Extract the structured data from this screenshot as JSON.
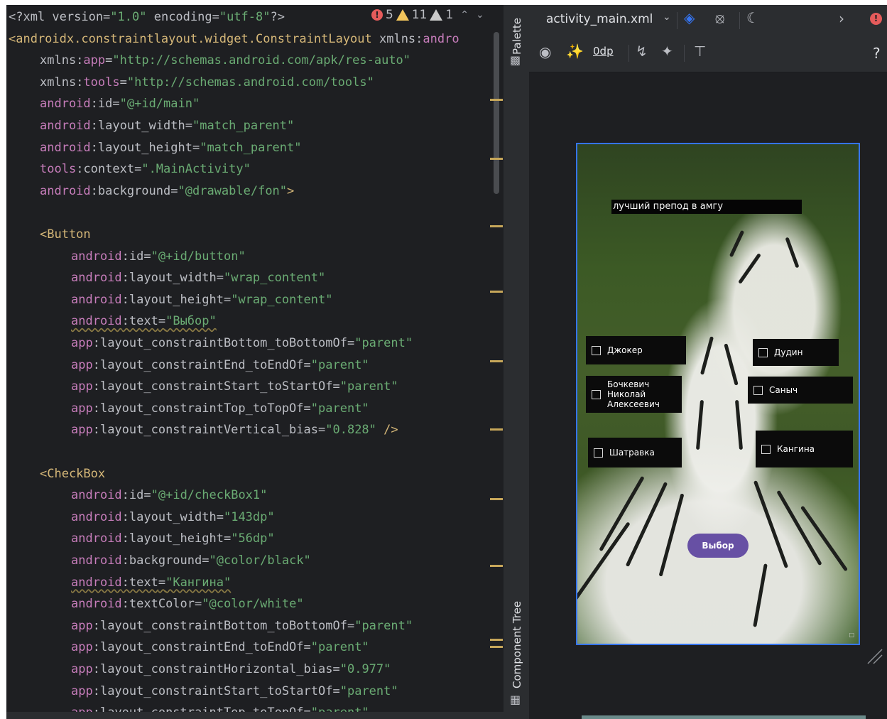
{
  "editor": {
    "inspections": {
      "errors": "5",
      "warnings": "11",
      "weak_warnings": "1"
    },
    "lines": [
      {
        "indent": 0,
        "parts": [
          [
            "decl",
            "<?xml version="
          ],
          [
            "str",
            "\"1.0\""
          ],
          [
            "decl",
            " encoding="
          ],
          [
            "str",
            "\"utf-8\""
          ],
          [
            "decl",
            "?>"
          ]
        ]
      },
      {
        "indent": 0,
        "parts": [
          [
            "tag",
            "<androidx.constraintlayout.widget.ConstraintLayout "
          ],
          [
            "attr",
            "xmlns:"
          ],
          [
            "ns",
            "andro"
          ]
        ]
      },
      {
        "indent": 1,
        "parts": [
          [
            "attr",
            "xmlns:"
          ],
          [
            "ns",
            "app"
          ],
          [
            "eq",
            "="
          ],
          [
            "str",
            "\"http://schemas.android.com/apk/res-auto\""
          ]
        ]
      },
      {
        "indent": 1,
        "parts": [
          [
            "attr",
            "xmlns:"
          ],
          [
            "ns",
            "tools"
          ],
          [
            "eq",
            "="
          ],
          [
            "str",
            "\"http://schemas.android.com/tools\""
          ]
        ]
      },
      {
        "indent": 1,
        "parts": [
          [
            "ns",
            "android"
          ],
          [
            "attr",
            ":id"
          ],
          [
            "eq",
            "="
          ],
          [
            "str",
            "\"@+id/main\""
          ]
        ]
      },
      {
        "indent": 1,
        "parts": [
          [
            "ns",
            "android"
          ],
          [
            "attr",
            ":layout_width"
          ],
          [
            "eq",
            "="
          ],
          [
            "str",
            "\"match_parent\""
          ]
        ]
      },
      {
        "indent": 1,
        "parts": [
          [
            "ns",
            "android"
          ],
          [
            "attr",
            ":layout_height"
          ],
          [
            "eq",
            "="
          ],
          [
            "str",
            "\"match_parent\""
          ]
        ]
      },
      {
        "indent": 1,
        "parts": [
          [
            "ns",
            "tools"
          ],
          [
            "attr",
            ":context"
          ],
          [
            "eq",
            "="
          ],
          [
            "str",
            "\".MainActivity\""
          ]
        ]
      },
      {
        "indent": 1,
        "parts": [
          [
            "ns",
            "android"
          ],
          [
            "attr",
            ":background"
          ],
          [
            "eq",
            "="
          ],
          [
            "str",
            "\"@drawable/fon\""
          ],
          [
            "punc",
            ">"
          ]
        ]
      },
      {
        "indent": 0,
        "parts": []
      },
      {
        "indent": 1,
        "parts": [
          [
            "tag",
            "<Button"
          ]
        ]
      },
      {
        "indent": 2,
        "parts": [
          [
            "ns",
            "android"
          ],
          [
            "attr",
            ":id"
          ],
          [
            "eq",
            "="
          ],
          [
            "str",
            "\"@+id/button\""
          ]
        ]
      },
      {
        "indent": 2,
        "parts": [
          [
            "ns",
            "android"
          ],
          [
            "attr",
            ":layout_width"
          ],
          [
            "eq",
            "="
          ],
          [
            "str",
            "\"wrap_content\""
          ]
        ]
      },
      {
        "indent": 2,
        "parts": [
          [
            "ns",
            "android"
          ],
          [
            "attr",
            ":layout_height"
          ],
          [
            "eq",
            "="
          ],
          [
            "str",
            "\"wrap_content\""
          ]
        ]
      },
      {
        "indent": 2,
        "warn": true,
        "parts": [
          [
            "ns",
            "android"
          ],
          [
            "attr",
            ":text"
          ],
          [
            "eq",
            "="
          ],
          [
            "str",
            "\"Выбор\""
          ]
        ]
      },
      {
        "indent": 2,
        "parts": [
          [
            "ns",
            "app"
          ],
          [
            "attr",
            ":layout_constraintBottom_toBottomOf"
          ],
          [
            "eq",
            "="
          ],
          [
            "str",
            "\"parent\""
          ]
        ]
      },
      {
        "indent": 2,
        "parts": [
          [
            "ns",
            "app"
          ],
          [
            "attr",
            ":layout_constraintEnd_toEndOf"
          ],
          [
            "eq",
            "="
          ],
          [
            "str",
            "\"parent\""
          ]
        ]
      },
      {
        "indent": 2,
        "parts": [
          [
            "ns",
            "app"
          ],
          [
            "attr",
            ":layout_constraintStart_toStartOf"
          ],
          [
            "eq",
            "="
          ],
          [
            "str",
            "\"parent\""
          ]
        ]
      },
      {
        "indent": 2,
        "parts": [
          [
            "ns",
            "app"
          ],
          [
            "attr",
            ":layout_constraintTop_toTopOf"
          ],
          [
            "eq",
            "="
          ],
          [
            "str",
            "\"parent\""
          ]
        ]
      },
      {
        "indent": 2,
        "parts": [
          [
            "ns",
            "app"
          ],
          [
            "attr",
            ":layout_constraintVertical_bias"
          ],
          [
            "eq",
            "="
          ],
          [
            "str",
            "\"0.828\""
          ],
          [
            "punc",
            " />"
          ]
        ]
      },
      {
        "indent": 0,
        "parts": []
      },
      {
        "indent": 1,
        "parts": [
          [
            "tag",
            "<CheckBox"
          ]
        ]
      },
      {
        "indent": 2,
        "parts": [
          [
            "ns",
            "android"
          ],
          [
            "attr",
            ":id"
          ],
          [
            "eq",
            "="
          ],
          [
            "str",
            "\"@+id/checkBox1\""
          ]
        ]
      },
      {
        "indent": 2,
        "parts": [
          [
            "ns",
            "android"
          ],
          [
            "attr",
            ":layout_width"
          ],
          [
            "eq",
            "="
          ],
          [
            "str",
            "\"143dp\""
          ]
        ]
      },
      {
        "indent": 2,
        "parts": [
          [
            "ns",
            "android"
          ],
          [
            "attr",
            ":layout_height"
          ],
          [
            "eq",
            "="
          ],
          [
            "str",
            "\"56dp\""
          ]
        ]
      },
      {
        "indent": 2,
        "parts": [
          [
            "ns",
            "android"
          ],
          [
            "attr",
            ":background"
          ],
          [
            "eq",
            "="
          ],
          [
            "str",
            "\"@color/black\""
          ]
        ]
      },
      {
        "indent": 2,
        "warn": true,
        "parts": [
          [
            "ns",
            "android"
          ],
          [
            "attr",
            ":text"
          ],
          [
            "eq",
            "="
          ],
          [
            "str",
            "\"Кангина\""
          ]
        ]
      },
      {
        "indent": 2,
        "parts": [
          [
            "ns",
            "android"
          ],
          [
            "attr",
            ":textColor"
          ],
          [
            "eq",
            "="
          ],
          [
            "str",
            "\"@color/white\""
          ]
        ]
      },
      {
        "indent": 2,
        "parts": [
          [
            "ns",
            "app"
          ],
          [
            "attr",
            ":layout_constraintBottom_toBottomOf"
          ],
          [
            "eq",
            "="
          ],
          [
            "str",
            "\"parent\""
          ]
        ]
      },
      {
        "indent": 2,
        "parts": [
          [
            "ns",
            "app"
          ],
          [
            "attr",
            ":layout_constraintEnd_toEndOf"
          ],
          [
            "eq",
            "="
          ],
          [
            "str",
            "\"parent\""
          ]
        ]
      },
      {
        "indent": 2,
        "parts": [
          [
            "ns",
            "app"
          ],
          [
            "attr",
            ":layout_constraintHorizontal_bias"
          ],
          [
            "eq",
            "="
          ],
          [
            "str",
            "\"0.977\""
          ]
        ]
      },
      {
        "indent": 2,
        "parts": [
          [
            "ns",
            "app"
          ],
          [
            "attr",
            ":layout_constraintStart_toStartOf"
          ],
          [
            "eq",
            "="
          ],
          [
            "str",
            "\"parent\""
          ]
        ]
      },
      {
        "indent": 2,
        "parts": [
          [
            "ns",
            "app"
          ],
          [
            "attr",
            ":layout_constraintTop_toTopOf"
          ],
          [
            "eq",
            "="
          ],
          [
            "str",
            "\"parent\""
          ]
        ]
      }
    ]
  },
  "tool_strip": {
    "palette_label": "Palette",
    "component_tree_label": "Component Tree"
  },
  "design": {
    "file_tab": "activity_main.xml",
    "margin_value": "0dp",
    "help_label": "?",
    "title_text": "лучший препод в амгу",
    "checkboxes": [
      {
        "id": "dzhoker",
        "label": "Джокер",
        "checked": false
      },
      {
        "id": "dudin",
        "label": "Дудин",
        "checked": false
      },
      {
        "id": "bochkevich",
        "label": "Бочкевич\nНиколай\nАлексеевич",
        "checked": false
      },
      {
        "id": "sanych",
        "label": "Саныч",
        "checked": false
      },
      {
        "id": "shatravka",
        "label": "Шатравка",
        "checked": false
      },
      {
        "id": "kangina",
        "label": "Кангина",
        "checked": false
      }
    ],
    "choose_button": "Выбор"
  },
  "colors": {
    "editor_bg": "#1e1f22",
    "string": "#6aab73",
    "tag": "#d5b778",
    "namespace": "#c77dbb",
    "selection_outline": "#3574f0",
    "material_button": "#6750a4",
    "error": "#e55b5b"
  }
}
